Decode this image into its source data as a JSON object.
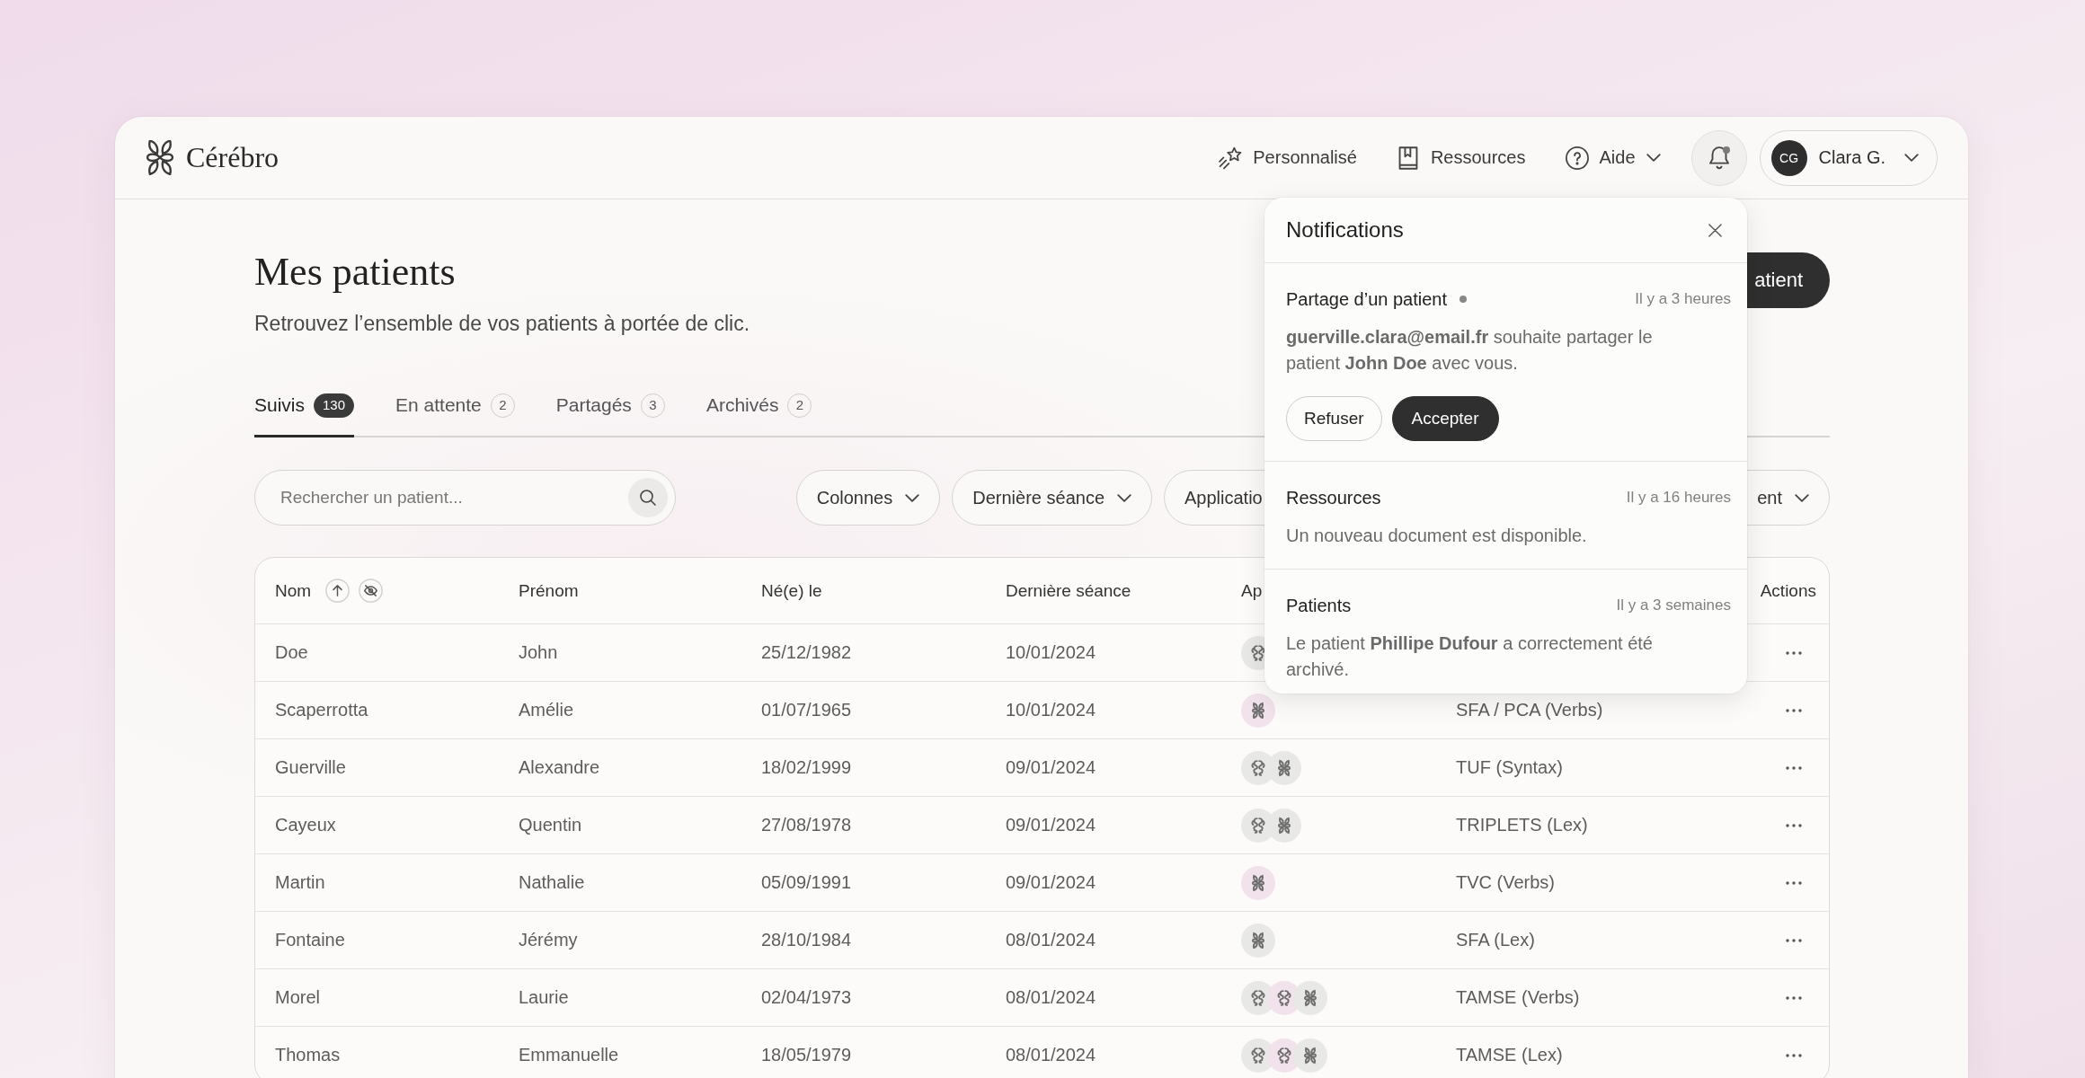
{
  "header": {
    "brand": "Cérébro",
    "nav": [
      {
        "label": "Personnalisé",
        "kind": "sparkle",
        "dropdown": false
      },
      {
        "label": "Ressources",
        "kind": "book",
        "dropdown": false
      },
      {
        "label": "Aide",
        "kind": "help",
        "dropdown": true
      }
    ],
    "notifications_unread": true,
    "user": {
      "initials": "CG",
      "name": "Clara G."
    }
  },
  "page": {
    "title": "Mes patients",
    "subtitle": "Retrouvez l’ensemble de vos patients à portée de clic.",
    "primary_button": "atient"
  },
  "tabs": [
    {
      "label": "Suivis",
      "count": "130",
      "selected": true
    },
    {
      "label": "En attente",
      "count": "2",
      "selected": false
    },
    {
      "label": "Partagés",
      "count": "3",
      "selected": false
    },
    {
      "label": "Archivés",
      "count": "2",
      "selected": false
    }
  ],
  "search": {
    "placeholder": "Rechercher un patient..."
  },
  "filters": [
    {
      "label": "Colonnes",
      "dropdown": true
    },
    {
      "label": "Dernière séance",
      "dropdown": true
    },
    {
      "label": "Applicatio"
    },
    {
      "label": "ent",
      "dropdown": true
    }
  ],
  "table": {
    "columns": [
      {
        "label": "Nom",
        "sort_ascending": true,
        "hide_toggle": true
      },
      {
        "label": "Prénom"
      },
      {
        "label": "Né(e) le"
      },
      {
        "label": "Dernière séance"
      },
      {
        "label": "Ap"
      }
    ],
    "actions_label": "Actions",
    "rows": [
      {
        "nom": "Doe",
        "prenom": "John",
        "ne_le": "25/12/1982",
        "derniere_seance": "10/01/2024",
        "column_5": [
          {
            "kind": "curl",
            "color": "#e8e8e6"
          }
        ]
      },
      {
        "nom": "Scaperrotta",
        "prenom": "Amélie",
        "ne_le": "01/07/1965",
        "derniere_seance": "10/01/2024",
        "column_5": [
          {
            "kind": "knot",
            "color": "#f2e2ec"
          }
        ],
        "column_6": "SFA / PCA (Verbs)"
      },
      {
        "nom": "Guerville",
        "prenom": "Alexandre",
        "ne_le": "18/02/1999",
        "derniere_seance": "09/01/2024",
        "column_5": [
          {
            "kind": "curl",
            "color": "#e8e8e6"
          },
          {
            "kind": "knot",
            "color": "#e8e8e6"
          }
        ],
        "column_6": "TUF (Syntax)"
      },
      {
        "nom": "Cayeux",
        "prenom": "Quentin",
        "ne_le": "27/08/1978",
        "derniere_seance": "09/01/2024",
        "column_5": [
          {
            "kind": "curl",
            "color": "#e8e8e6"
          },
          {
            "kind": "knot",
            "color": "#e8e8e6"
          }
        ],
        "column_6": "TRIPLETS (Lex)"
      },
      {
        "nom": "Martin",
        "prenom": "Nathalie",
        "ne_le": "05/09/1991",
        "derniere_seance": "09/01/2024",
        "column_5": [
          {
            "kind": "knot",
            "color": "#f2e2ec"
          }
        ],
        "column_6": "TVC (Verbs)"
      },
      {
        "nom": "Fontaine",
        "prenom": "Jérémy",
        "ne_le": "28/10/1984",
        "derniere_seance": "08/01/2024",
        "column_5": [
          {
            "kind": "knot",
            "color": "#e8e8e6"
          }
        ],
        "column_6": "SFA (Lex)"
      },
      {
        "nom": "Morel",
        "prenom": "Laurie",
        "ne_le": "02/04/1973",
        "derniere_seance": "08/01/2024",
        "column_5": [
          {
            "kind": "curl",
            "color": "#e8e8e6"
          },
          {
            "kind": "curl",
            "color": "#f2e2ec"
          },
          {
            "kind": "knot",
            "color": "#e8e8e6"
          }
        ],
        "column_6": "TAMSE (Verbs)"
      },
      {
        "nom": "Thomas",
        "prenom": "Emmanuelle",
        "ne_le": "18/05/1979",
        "derniere_seance": "08/01/2024",
        "column_5": [
          {
            "kind": "curl",
            "color": "#e8e8e6"
          },
          {
            "kind": "curl",
            "color": "#f2e2ec"
          },
          {
            "kind": "knot",
            "color": "#e8e8e6"
          }
        ],
        "column_6": "TAMSE (Lex)"
      }
    ]
  },
  "notifications": {
    "title": "Notifications",
    "items": [
      {
        "title": "Partage d’un patient",
        "unread": true,
        "time": "Il y a 3 heures",
        "text": "**guerville.clara@email.fr** souhaite partager le patient **John Doe** avec vous.",
        "actions": [
          {
            "label": "Refuser",
            "kind": "secondary"
          },
          {
            "label": "Accepter",
            "kind": "primary"
          }
        ]
      },
      {
        "title": "Ressources",
        "unread": false,
        "time": "Il y a 16 heures",
        "text": "Un nouveau document est disponible."
      },
      {
        "title": "Patients",
        "unread": false,
        "time": "Il y a 3 semaines",
        "text": "Le patient **Phillipe Dufour** a correctement été archivé."
      }
    ]
  }
}
